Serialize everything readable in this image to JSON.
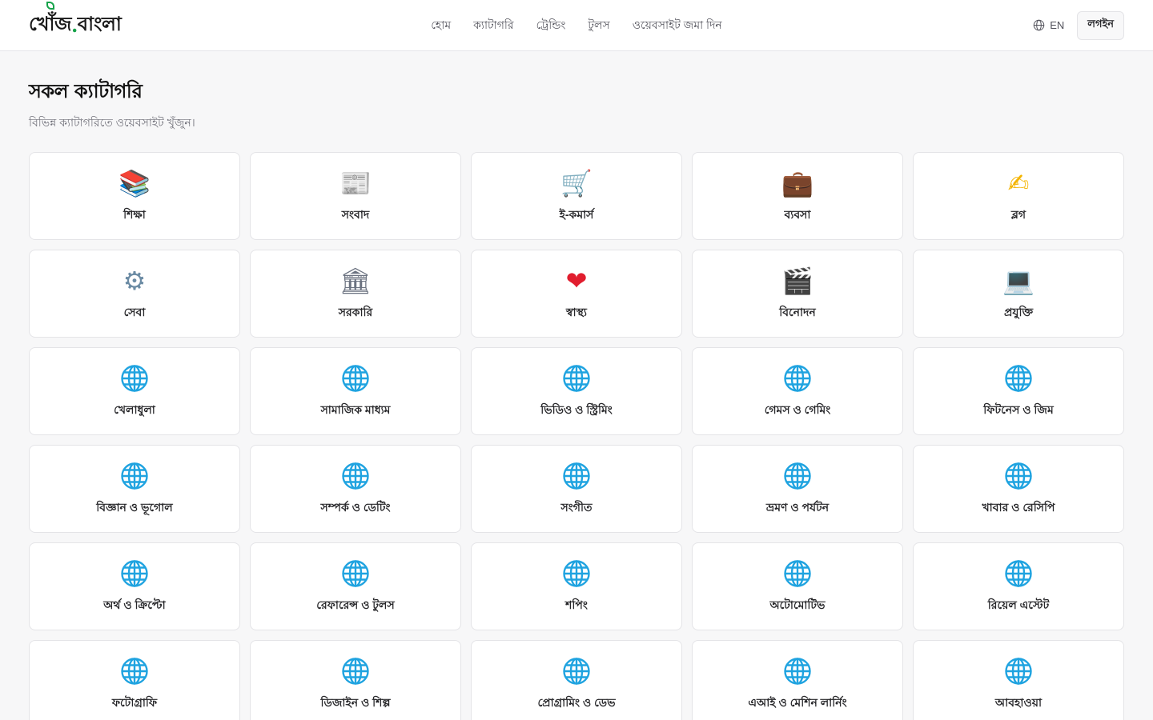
{
  "brand": {
    "logo_main": "খোঁজ",
    "logo_dot": ".",
    "logo_tail": "বাংলা"
  },
  "nav": [
    {
      "label": "হোম"
    },
    {
      "label": "ক্যাটাগরি"
    },
    {
      "label": "ট্রেন্ডিং"
    },
    {
      "label": "টুলস"
    },
    {
      "label": "ওয়েবসাইট জমা দিন"
    }
  ],
  "header_right": {
    "lang_label": "EN",
    "login_label": "লগইন"
  },
  "page": {
    "title": "সকল ক্যাটাগরি",
    "subtitle": "বিভিন্ন ক্যাটাগরিতে ওয়েবসাইট খুঁজুন।"
  },
  "colors": {
    "accent": "#16a34a",
    "globe": "#1fa3e0"
  },
  "categories": [
    {
      "label": "শিক্ষা",
      "icon": "books-icon",
      "glyph": "📚",
      "color": "#c0392b"
    },
    {
      "label": "সংবাদ",
      "icon": "newspaper-icon",
      "glyph": "📰",
      "color": "#6b7280"
    },
    {
      "label": "ই-কমার্স",
      "icon": "shopping-cart-icon",
      "glyph": "🛒",
      "color": "#6b7280"
    },
    {
      "label": "ব্যবসা",
      "icon": "briefcase-icon",
      "glyph": "💼",
      "color": "#8b4513"
    },
    {
      "label": "ব্লগ",
      "icon": "writing-hand-icon",
      "glyph": "✍",
      "color": "#f4b400"
    },
    {
      "label": "সেবা",
      "icon": "gear-icon",
      "glyph": "⚙",
      "color": "#6b8ba4"
    },
    {
      "label": "সরকারি",
      "icon": "classical-building-icon",
      "glyph": "🏛",
      "color": "#6b7280"
    },
    {
      "label": "স্বাস্থ্য",
      "icon": "heart-icon",
      "glyph": "❤",
      "color": "#e11d2e"
    },
    {
      "label": "বিনোদন",
      "icon": "clapper-board-icon",
      "glyph": "🎬",
      "color": "#27272a"
    },
    {
      "label": "প্রযুক্তি",
      "icon": "laptop-icon",
      "glyph": "💻",
      "color": "#4b5563"
    },
    {
      "label": "খেলাধুলা",
      "icon": "globe-icon"
    },
    {
      "label": "সামাজিক মাধ্যম",
      "icon": "globe-icon"
    },
    {
      "label": "ভিডিও ও স্ট্রিমিং",
      "icon": "globe-icon"
    },
    {
      "label": "গেমস ও গেমিং",
      "icon": "globe-icon"
    },
    {
      "label": "ফিটনেস ও জিম",
      "icon": "globe-icon"
    },
    {
      "label": "বিজ্ঞান ও ভূগোল",
      "icon": "globe-icon"
    },
    {
      "label": "সম্পর্ক ও ডেটিং",
      "icon": "globe-icon"
    },
    {
      "label": "সংগীত",
      "icon": "globe-icon"
    },
    {
      "label": "ভ্রমণ ও পর্যটন",
      "icon": "globe-icon"
    },
    {
      "label": "খাবার ও রেসিপি",
      "icon": "globe-icon"
    },
    {
      "label": "অর্থ ও ক্রিপ্টো",
      "icon": "globe-icon"
    },
    {
      "label": "রেফারেন্স ও টুলস",
      "icon": "globe-icon"
    },
    {
      "label": "শপিং",
      "icon": "globe-icon"
    },
    {
      "label": "অটোমোটিভ",
      "icon": "globe-icon"
    },
    {
      "label": "রিয়েল এস্টেট",
      "icon": "globe-icon"
    },
    {
      "label": "ফটোগ্রাফি",
      "icon": "globe-icon"
    },
    {
      "label": "ডিজাইন ও শিল্প",
      "icon": "globe-icon"
    },
    {
      "label": "প্রোগ্রামিং ও ডেভ",
      "icon": "globe-icon"
    },
    {
      "label": "এআই ও মেশিন লার্নিং",
      "icon": "globe-icon"
    },
    {
      "label": "আবহাওয়া",
      "icon": "globe-icon"
    }
  ]
}
